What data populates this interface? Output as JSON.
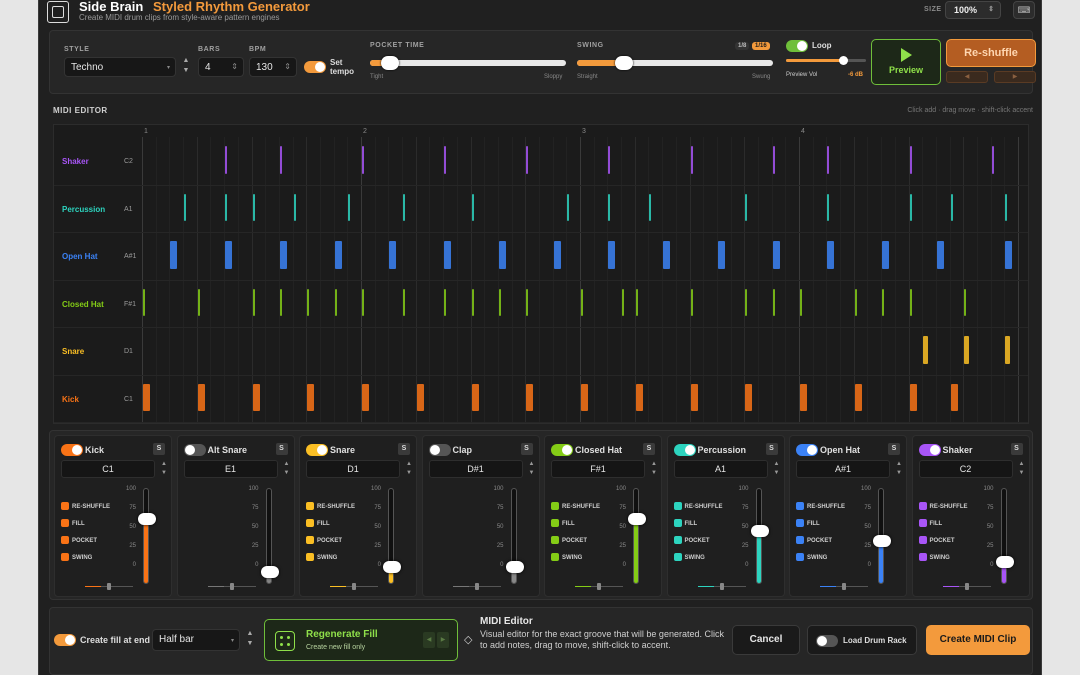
{
  "header": {
    "brand": "Side Brain",
    "app_title": "Styled Rhythm Generator",
    "tagline": "Create MIDI drum clips from style-aware pattern engines",
    "size_label": "SIZE",
    "size_value": "100%",
    "keyboard_icon": "keyboard-icon"
  },
  "controls": {
    "style_label": "STYLE",
    "style_value": "Techno",
    "bars_label": "BARS",
    "bars_value": "4",
    "bpm_label": "BPM",
    "bpm_value": "130",
    "set_tempo_label": "Set tempo",
    "set_tempo_on": true,
    "pocket_label": "POCKET TIME",
    "pocket_min": "Tight",
    "pocket_max": "Sloppy",
    "pocket_value": 0.1,
    "swing_label": "SWING",
    "swing_min": "Straight",
    "swing_max": "Swung",
    "swing_value": 0.24,
    "swing_res": [
      "1/8",
      "1/16"
    ],
    "swing_res_selected": "1/16",
    "loop_label": "Loop",
    "loop_on": true,
    "preview_vol_label": "Preview Vol",
    "preview_vol_value": "-6 dB",
    "preview_vol_level": 0.72,
    "preview_label": "Preview",
    "reshuffle_label": "Re-shuffle",
    "prev_arrow": "◀",
    "next_arrow": "▶"
  },
  "editor": {
    "title": "MIDI EDITOR",
    "hint": "Click add · drag move · shift-click accent",
    "bars": [
      "1",
      "2",
      "3",
      "4"
    ],
    "steps": 64,
    "rows": [
      {
        "name": "Shaker",
        "note": "C2",
        "color": "#a855f7",
        "steps": [
          6,
          10,
          16,
          22,
          28,
          34,
          40,
          46,
          50,
          56,
          62
        ]
      },
      {
        "name": "Percussion",
        "note": "A1",
        "color": "#2dd4bf",
        "steps": [
          3,
          6,
          8,
          11,
          15,
          19,
          24,
          31,
          34,
          37,
          44,
          50,
          56,
          59,
          63
        ]
      },
      {
        "name": "Open Hat",
        "note": "A#1",
        "color": "#3b82f6",
        "steps": [
          2,
          6,
          10,
          14,
          18,
          22,
          26,
          30,
          34,
          38,
          42,
          46,
          50,
          54,
          58,
          63
        ]
      },
      {
        "name": "Closed Hat",
        "note": "F#1",
        "color": "#84cc16",
        "steps": [
          0,
          4,
          8,
          10,
          12,
          14,
          16,
          19,
          22,
          24,
          26,
          28,
          32,
          35,
          36,
          40,
          44,
          46,
          48,
          52,
          54,
          56,
          60
        ]
      },
      {
        "name": "Snare",
        "note": "D1",
        "color": "#fbbf24",
        "steps": [
          57,
          60,
          63
        ]
      },
      {
        "name": "Kick",
        "note": "C1",
        "color": "#f97316",
        "steps": [
          0,
          4,
          8,
          12,
          16,
          20,
          24,
          28,
          32,
          36,
          40,
          44,
          48,
          52,
          56,
          59
        ]
      }
    ]
  },
  "mixer": {
    "scale": [
      "100",
      "75",
      "50",
      "25",
      "0"
    ],
    "channels": [
      {
        "name": "Kick",
        "note": "C1",
        "color": "#f97316",
        "on": true,
        "level": 0.68,
        "options": [
          "RE-SHUFFLE",
          "FILL",
          "POCKET",
          "SWING"
        ]
      },
      {
        "name": "Alt Snare",
        "note": "E1",
        "color": "#9ca3af",
        "on": false,
        "level": 0.12,
        "options": []
      },
      {
        "name": "Snare",
        "note": "D1",
        "color": "#fbbf24",
        "on": true,
        "level": 0.18,
        "options": [
          "RE-SHUFFLE",
          "FILL",
          "POCKET",
          "SWING"
        ]
      },
      {
        "name": "Clap",
        "note": "D#1",
        "color": "#9ca3af",
        "on": false,
        "level": 0.18,
        "options": []
      },
      {
        "name": "Closed Hat",
        "note": "F#1",
        "color": "#84cc16",
        "on": true,
        "level": 0.68,
        "options": [
          "RE-SHUFFLE",
          "FILL",
          "POCKET",
          "SWING"
        ]
      },
      {
        "name": "Percussion",
        "note": "A1",
        "color": "#2dd4bf",
        "on": true,
        "level": 0.55,
        "options": [
          "RE-SHUFFLE",
          "FILL",
          "POCKET",
          "SWING"
        ]
      },
      {
        "name": "Open Hat",
        "note": "A#1",
        "color": "#3b82f6",
        "on": true,
        "level": 0.45,
        "options": [
          "RE-SHUFFLE",
          "FILL",
          "POCKET",
          "SWING"
        ]
      },
      {
        "name": "Shaker",
        "note": "C2",
        "color": "#a855f7",
        "on": true,
        "level": 0.23,
        "options": [
          "RE-SHUFFLE",
          "FILL",
          "POCKET",
          "SWING"
        ]
      }
    ],
    "solo_label": "S"
  },
  "footer": {
    "fill_label": "Create fill at end",
    "fill_on": true,
    "fill_length": "Half bar",
    "regen_title": "Regenerate Fill",
    "regen_sub": "Create new fill only",
    "info_title": "MIDI Editor",
    "info_text": "Visual editor for the exact groove that will be generated. Click to add notes, drag to move, shift-click to accent.",
    "cancel_label": "Cancel",
    "load_rack_label": "Load Drum Rack",
    "load_rack_on": false,
    "create_label": "Create MIDI Clip"
  }
}
